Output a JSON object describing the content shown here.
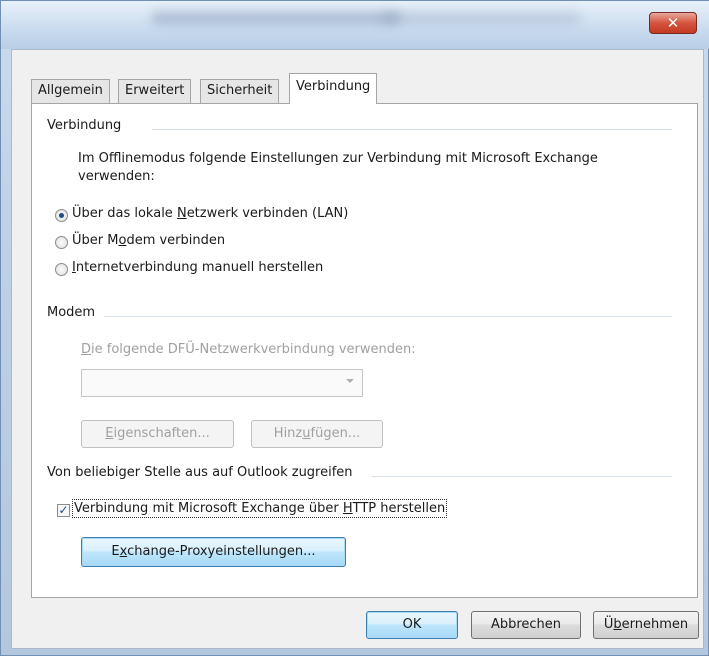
{
  "window": {
    "close_glyph": "✕"
  },
  "tabs": [
    {
      "label": "Allgemein"
    },
    {
      "label": "Erweitert"
    },
    {
      "label": "Sicherheit"
    },
    {
      "label": "Verbindung",
      "active": true
    }
  ],
  "connection": {
    "group_title": "Verbindung",
    "description": "Im Offlinemodus folgende Einstellungen zur Verbindung mit Microsoft Exchange verwenden:",
    "description_line1": "Im Offlinemodus folgende Einstellungen zur Verbindung mit Microsoft Exchange",
    "description_line2": "verwenden:",
    "options": [
      {
        "label": "Über das lokale Netzwerk verbinden (LAN)",
        "selected": true
      },
      {
        "label": "Über Modem verbinden",
        "selected": false
      },
      {
        "label": "Internetverbindung manuell herstellen",
        "selected": false
      }
    ]
  },
  "modem": {
    "group_title": "Modem",
    "dialup_label": "Die folgende DFÜ-Netzwerkverbindung verwenden:",
    "dialup_value": "",
    "properties_button": "Eigenschaften...",
    "add_button": "Hinzufügen..."
  },
  "outlook_anywhere": {
    "group_title": "Von beliebiger Stelle aus auf Outlook zugreifen",
    "http_checkbox_label": "Verbindung mit Microsoft Exchange über HTTP herstellen",
    "http_checked": true,
    "proxy_button": "Exchange-Proxyeinstellungen..."
  },
  "footer": {
    "ok": "OK",
    "cancel": "Abbrechen",
    "apply": "Übernehmen"
  }
}
